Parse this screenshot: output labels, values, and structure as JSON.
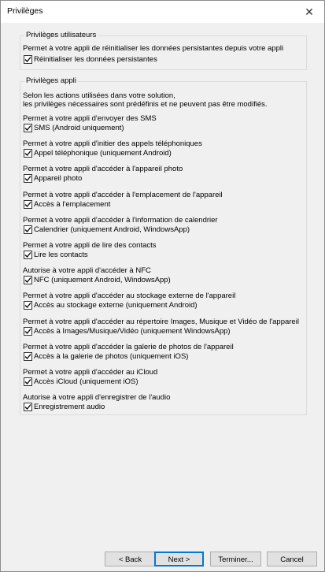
{
  "window": {
    "title": "Privilèges",
    "close_glyph": "✕"
  },
  "user_privileges": {
    "title": "Privilèges utilisateurs",
    "description": "Permet à votre appli de réinitialiser les données persistantes depuis votre appli",
    "checkbox_label": "Réinitialiser les données persistantes",
    "checked": true
  },
  "app_privileges": {
    "title": "Privilèges appli",
    "intro_line1": "Selon les actions utilisées dans votre solution,",
    "intro_line2": "les privilèges nécessaires sont prédéfinis et ne peuvent pas être modifiés.",
    "items": [
      {
        "description": "Permet à votre appli d'envoyer des SMS",
        "label": "SMS (Android uniquement)",
        "checked": true
      },
      {
        "description": "Permet à votre appli d'initier des appels téléphoniques",
        "label": "Appel téléphonique (uniquement Android)",
        "checked": true
      },
      {
        "description": "Permet à votre appli d'accéder à l'appareil photo",
        "label": "Appareil photo",
        "checked": true
      },
      {
        "description": "Permet à votre appli d'accéder à l'emplacement de l'appareil",
        "label": "Accès à l'emplacement",
        "checked": true
      },
      {
        "description": "Permet à votre appli d'accéder à l'information de calendrier",
        "label": "Calendrier (uniquement Android, WindowsApp)",
        "checked": true
      },
      {
        "description": "Permet à votre appli de lire des contacts",
        "label": "Lire les contacts",
        "checked": true
      },
      {
        "description": "Autorise à votre appli d'accéder à NFC",
        "label": "NFC (uniquement Android, WindowsApp)",
        "checked": true
      },
      {
        "description": "Permet à votre appli d'accéder au stockage externe de l'appareil",
        "label": "Accès au stockage externe (uniquement Android)",
        "checked": true
      },
      {
        "description": "Permet à votre appli d'accéder au répertoire Images, Musique et Vidéo de l'appareil",
        "label": "Accès à Images/Musique/Vidéo (uniquement WindowsApp)",
        "checked": true
      },
      {
        "description": "Permet à votre appli d'accéder la galerie de photos de l'appareil",
        "label": "Accès à la galerie de photos (uniquement iOS)",
        "checked": true
      },
      {
        "description": "Permet à votre appli d'accéder au iCloud",
        "label": "Accès iCloud (uniquement iOS)",
        "checked": true
      },
      {
        "description": "Autorise à votre appli d'enregistrer de l'audio",
        "label": "Enregistrement audio",
        "checked": true
      }
    ]
  },
  "buttons": {
    "back": "< Back",
    "next": "Next >",
    "finish": "Terminer...",
    "cancel": "Cancel"
  }
}
